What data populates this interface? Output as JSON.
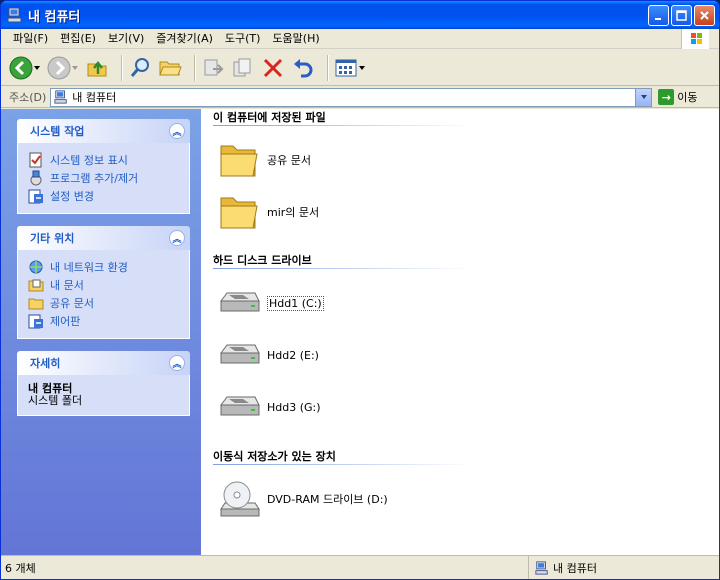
{
  "window": {
    "title": "내 컴퓨터"
  },
  "menu": [
    "파일(F)",
    "편집(E)",
    "보기(V)",
    "즐겨찾기(A)",
    "도구(T)",
    "도움말(H)"
  ],
  "address": {
    "label": "주소(D)",
    "value": "내 컴퓨터",
    "go_label": "이동"
  },
  "sidebar": {
    "system_tasks": {
      "title": "시스템 작업",
      "items": [
        "시스템 정보 표시",
        "프로그램 추가/제거",
        "설정 변경"
      ]
    },
    "other_places": {
      "title": "기타 위치",
      "items": [
        "내 네트워크 환경",
        "내 문서",
        "공유 문서",
        "제어판"
      ]
    },
    "details": {
      "title": "자세히",
      "name": "내 컴퓨터",
      "type": "시스템 폴더"
    }
  },
  "content": {
    "files_group": {
      "title": "이 컴퓨터에 저장된 파일",
      "items": [
        "공유 문서",
        "mir의 문서"
      ]
    },
    "hdd_group": {
      "title": "하드 디스크 드라이브",
      "items": [
        "Hdd1 (C:)",
        "Hdd2 (E:)",
        "Hdd3 (G:)"
      ]
    },
    "removable_group": {
      "title": "이동식 저장소가 있는 장치",
      "items": [
        "DVD-RAM 드라이브 (D:)"
      ]
    }
  },
  "status": {
    "count": "6 개체",
    "location": "내 컴퓨터"
  }
}
